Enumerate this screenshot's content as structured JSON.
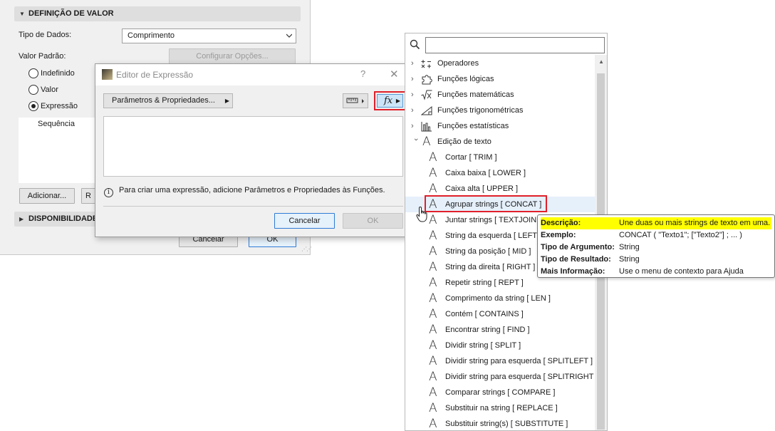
{
  "settings_panel": {
    "section_value": "DEFINIÇÃO DE VALOR",
    "data_type_label": "Tipo de Dados:",
    "data_type_value": "Comprimento",
    "default_value_label": "Valor Padrão:",
    "configure_options": "Configurar Opções...",
    "radios": [
      {
        "label": "Indefinido",
        "checked": false
      },
      {
        "label": "Valor",
        "checked": false
      },
      {
        "label": "Expressão",
        "checked": true
      }
    ],
    "sequence_item": "Sequência",
    "add_button": "Adicionar...",
    "second_button_fragment": "R",
    "section_availability": "DISPONIBILIDADE",
    "cancel": "Cancelar",
    "ok": "OK"
  },
  "expression_editor": {
    "title": "Editor de Expressão",
    "help": "?",
    "close": "✕",
    "params_button": "Parâmetros & Propriedades...",
    "fx_label": "fx",
    "info_text": "Para criar uma expressão, adicione Parâmetros e Propriedades às Funções.",
    "cancel": "Cancelar",
    "ok": "OK"
  },
  "function_menu": {
    "search_placeholder": "",
    "categories": [
      {
        "label": "Operadores",
        "icon": "operators-icon",
        "expanded": false
      },
      {
        "label": "Funções lógicas",
        "icon": "puzzle-icon",
        "expanded": false
      },
      {
        "label": "Funções matemáticas",
        "icon": "sqrt-x-icon",
        "expanded": false
      },
      {
        "label": "Funções trigonométricas",
        "icon": "triangle-icon",
        "expanded": false
      },
      {
        "label": "Funções estatísticas",
        "icon": "bar-chart-icon",
        "expanded": false
      },
      {
        "label": "Edição de texto",
        "icon": "text-a-icon",
        "expanded": true
      }
    ],
    "text_functions": [
      "Cortar [ TRIM ]",
      "Caixa baixa [ LOWER ]",
      "Caixa alta [ UPPER ]",
      "Agrupar strings [ CONCAT ]",
      "Juntar strings [ TEXTJOIN ]",
      "String da esquerda [ LEFT ]",
      "String da posição [ MID ]",
      "String da direita [ RIGHT ]",
      "Repetir string [ REPT ]",
      "Comprimento da string [ LEN ]",
      "Contém [ CONTAINS ]",
      "Encontrar string [ FIND ]",
      "Dividir string [ SPLIT ]",
      "Dividir string para esquerda [ SPLITLEFT ]",
      "Dividir string para esquerda [ SPLITRIGHT ]",
      "Comparar strings [ COMPARE ]",
      "Substituir na string [ REPLACE ]",
      "Substituir string(s) [ SUBSTITUTE ]"
    ],
    "highlighted_index": 3
  },
  "tooltip": {
    "rows": [
      {
        "key": "Descrição:",
        "value": "Une duas ou mais strings de texto em uma."
      },
      {
        "key": "Exemplo:",
        "value": "CONCAT ( \"Texto1\"; [\"Texto2\"] ; ... )"
      },
      {
        "key": "Tipo de Argumento:",
        "value": "String"
      },
      {
        "key": "Tipo de Resultado:",
        "value": "String"
      },
      {
        "key": "Mais Informação:",
        "value": "Use o menu de contexto para Ajuda"
      }
    ],
    "highlight_color": "#ffff00"
  },
  "colors": {
    "accent_red": "#e0202a",
    "fx_button_bg": "#cce4f7",
    "hover_row": "#e5f0fb",
    "primary_border": "#2f7bd6"
  }
}
